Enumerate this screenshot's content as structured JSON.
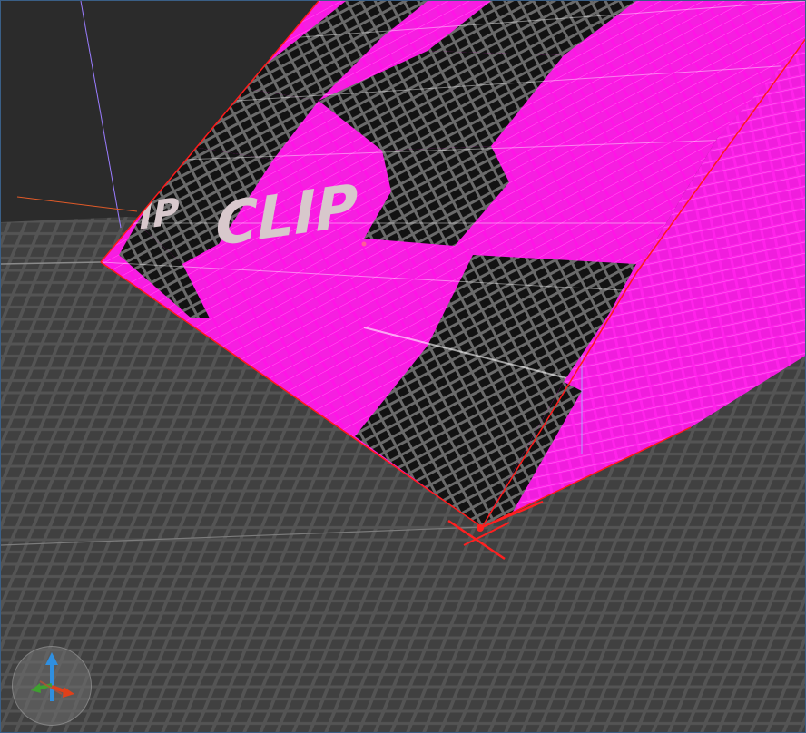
{
  "viewport": {
    "name": "3d-viewport",
    "background": "#2b2b2b",
    "grid_color": "#5a5a5a",
    "grid_tile_color": "#494949",
    "object": {
      "texture_primary": "#ff14e6",
      "texture_secondary": "#121212",
      "texture_label": "CLIP",
      "texture_label_partial": "IP",
      "label_color": "#d8c8cc",
      "edge_color": "#ff1a1a"
    },
    "pivot_color": "#ff2020"
  },
  "gizmo": {
    "name": "axis-gizmo",
    "axis_up_color": "#2f8fe0",
    "axis_x_color": "#e0401a",
    "axis_z_color": "#3fa030"
  }
}
